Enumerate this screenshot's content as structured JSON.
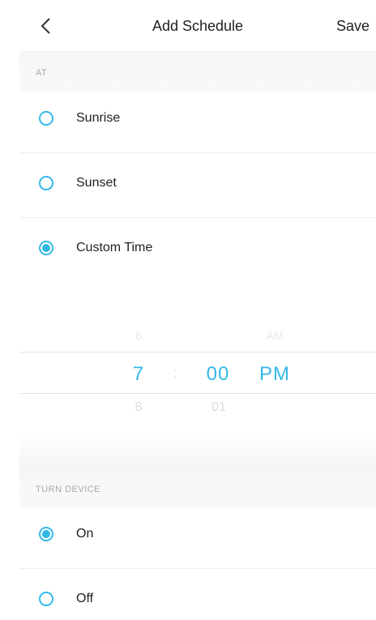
{
  "header": {
    "title": "Add Schedule",
    "save_label": "Save",
    "back_icon": "chevron-left-icon"
  },
  "sections": {
    "at_label": "AT",
    "turn_device_label": "TURN DEVICE"
  },
  "at_options": [
    {
      "label": "Sunrise",
      "checked": false
    },
    {
      "label": "Sunset",
      "checked": false
    },
    {
      "label": "Custom Time",
      "checked": true
    }
  ],
  "time_picker": {
    "hour_prev": "6",
    "hour": "7",
    "hour_next": "8",
    "separator": ":",
    "minute": "00",
    "minute_next": "01",
    "ampm_prev": "AM",
    "ampm": "PM"
  },
  "turn_options": [
    {
      "label": "On",
      "checked": true
    },
    {
      "label": "Off",
      "checked": false
    }
  ],
  "colors": {
    "accent": "#33b9e9",
    "section_bg": "#f7f7f7",
    "section_text": "#a8a8a8"
  }
}
